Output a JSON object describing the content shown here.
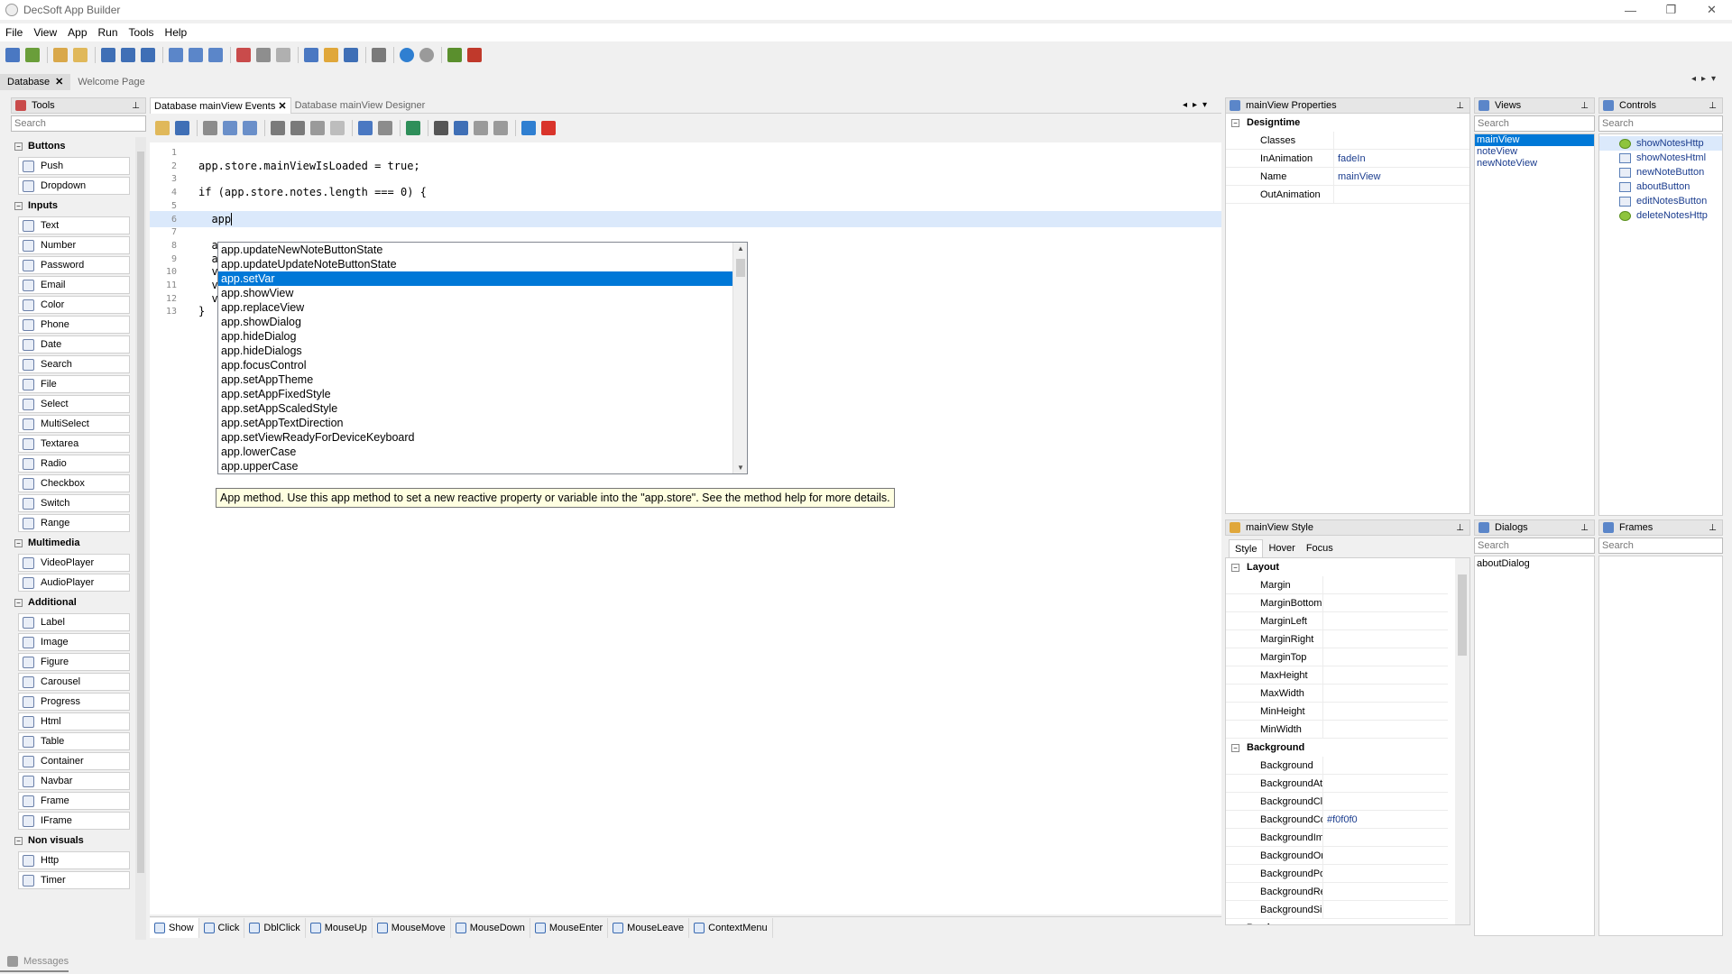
{
  "window": {
    "title": "DecSoft App Builder",
    "controls": [
      "—",
      "❐",
      "✕"
    ]
  },
  "menu": [
    "File",
    "View",
    "App",
    "Run",
    "Tools",
    "Help"
  ],
  "doc_tabs": [
    {
      "label": "Database",
      "active": true
    },
    {
      "label": "Welcome Page",
      "active": false
    }
  ],
  "tools": {
    "title": "Tools",
    "search_placeholder": "Search",
    "categories": [
      {
        "name": "Buttons",
        "items": [
          "Push",
          "Dropdown"
        ]
      },
      {
        "name": "Inputs",
        "items": [
          "Text",
          "Number",
          "Password",
          "Email",
          "Color",
          "Phone",
          "Date",
          "Search",
          "File",
          "Select",
          "MultiSelect",
          "Textarea",
          "Radio",
          "Checkbox",
          "Switch",
          "Range"
        ]
      },
      {
        "name": "Multimedia",
        "items": [
          "VideoPlayer",
          "AudioPlayer"
        ]
      },
      {
        "name": "Additional",
        "items": [
          "Label",
          "Image",
          "Figure",
          "Carousel",
          "Progress",
          "Html",
          "Table",
          "Container",
          "Navbar",
          "Frame",
          "IFrame"
        ]
      },
      {
        "name": "Non visuals",
        "items": [
          "Http",
          "Timer"
        ]
      }
    ]
  },
  "editor": {
    "tabs": [
      {
        "label": "Database mainView Events",
        "active": true
      },
      {
        "label": "Database mainView Designer",
        "active": false
      }
    ],
    "lines": [
      {
        "n": "1",
        "code": ""
      },
      {
        "n": "2",
        "code": "app.store.mainViewIsLoaded = true;"
      },
      {
        "n": "3",
        "code": ""
      },
      {
        "n": "4",
        "code": "if (app.store.notes.length === 0) {"
      },
      {
        "n": "5",
        "code": ""
      },
      {
        "n": "6",
        "code": "  app"
      },
      {
        "n": "7",
        "code": ""
      },
      {
        "n": "8",
        "code": "  a"
      },
      {
        "n": "9",
        "code": "  a"
      },
      {
        "n": "10",
        "code": "  v"
      },
      {
        "n": "11",
        "code": "  v"
      },
      {
        "n": "12",
        "code": "  v"
      },
      {
        "n": "13",
        "code": "}"
      }
    ],
    "autocomplete": [
      "app.updateNewNoteButtonState",
      "app.updateUpdateNoteButtonState",
      "app.setVar",
      "app.showView",
      "app.replaceView",
      "app.showDialog",
      "app.hideDialog",
      "app.hideDialogs",
      "app.focusControl",
      "app.setAppTheme",
      "app.setAppFixedStyle",
      "app.setAppScaledStyle",
      "app.setAppTextDirection",
      "app.setViewReadyForDeviceKeyboard",
      "app.lowerCase",
      "app.upperCase"
    ],
    "autocomplete_selected": 2,
    "tooltip": "App method. Use this app method to set a new reactive property or variable into the \"app.store\". See the method help for more details.",
    "event_tabs": [
      "Show",
      "Click",
      "DblClick",
      "MouseUp",
      "MouseMove",
      "MouseDown",
      "MouseEnter",
      "MouseLeave",
      "ContextMenu"
    ]
  },
  "properties": {
    "title": "mainView Properties",
    "section": "Designtime",
    "rows": [
      {
        "name": "Classes",
        "value": ""
      },
      {
        "name": "InAnimation",
        "value": "fadeIn"
      },
      {
        "name": "Name",
        "value": "mainView"
      },
      {
        "name": "OutAnimation",
        "value": ""
      }
    ]
  },
  "views": {
    "title": "Views",
    "search_placeholder": "Search",
    "items": [
      "mainView",
      "noteView",
      "newNoteView"
    ],
    "selected": 0
  },
  "controls": {
    "title": "Controls",
    "search_placeholder": "Search",
    "items": [
      {
        "name": "showNotesHttp",
        "kind": "http"
      },
      {
        "name": "showNotesHtml",
        "kind": "html"
      },
      {
        "name": "newNoteButton",
        "kind": "button"
      },
      {
        "name": "aboutButton",
        "kind": "button"
      },
      {
        "name": "editNotesButton",
        "kind": "button"
      },
      {
        "name": "deleteNotesHttp",
        "kind": "http"
      }
    ]
  },
  "style": {
    "title": "mainView Style",
    "tabs": [
      "Style",
      "Hover",
      "Focus"
    ],
    "sections": [
      {
        "name": "Layout",
        "rows": [
          {
            "name": "Margin",
            "value": ""
          },
          {
            "name": "MarginBottom",
            "value": ""
          },
          {
            "name": "MarginLeft",
            "value": ""
          },
          {
            "name": "MarginRight",
            "value": ""
          },
          {
            "name": "MarginTop",
            "value": ""
          },
          {
            "name": "MaxHeight",
            "value": ""
          },
          {
            "name": "MaxWidth",
            "value": ""
          },
          {
            "name": "MinHeight",
            "value": ""
          },
          {
            "name": "MinWidth",
            "value": ""
          }
        ]
      },
      {
        "name": "Background",
        "rows": [
          {
            "name": "Background",
            "value": ""
          },
          {
            "name": "BackgroundAtta...",
            "value": ""
          },
          {
            "name": "BackgroundClip",
            "value": ""
          },
          {
            "name": "BackgroundColor",
            "value": "#f0f0f0"
          },
          {
            "name": "BackgroundImage",
            "value": ""
          },
          {
            "name": "BackgroundOrigin",
            "value": ""
          },
          {
            "name": "BackgroundPosi...",
            "value": ""
          },
          {
            "name": "BackgroundRep...",
            "value": ""
          },
          {
            "name": "BackgroundSize",
            "value": ""
          }
        ]
      },
      {
        "name": "Border",
        "rows": []
      }
    ]
  },
  "dialogs": {
    "title": "Dialogs",
    "search_placeholder": "Search",
    "items": [
      "aboutDialog"
    ]
  },
  "frames": {
    "title": "Frames",
    "search_placeholder": "Search",
    "items": []
  },
  "status": {
    "label": "Messages"
  },
  "colors": {
    "selection": "#0078d7",
    "tooltip_bg": "#ffffe1",
    "current_line": "#dbe9fb"
  }
}
